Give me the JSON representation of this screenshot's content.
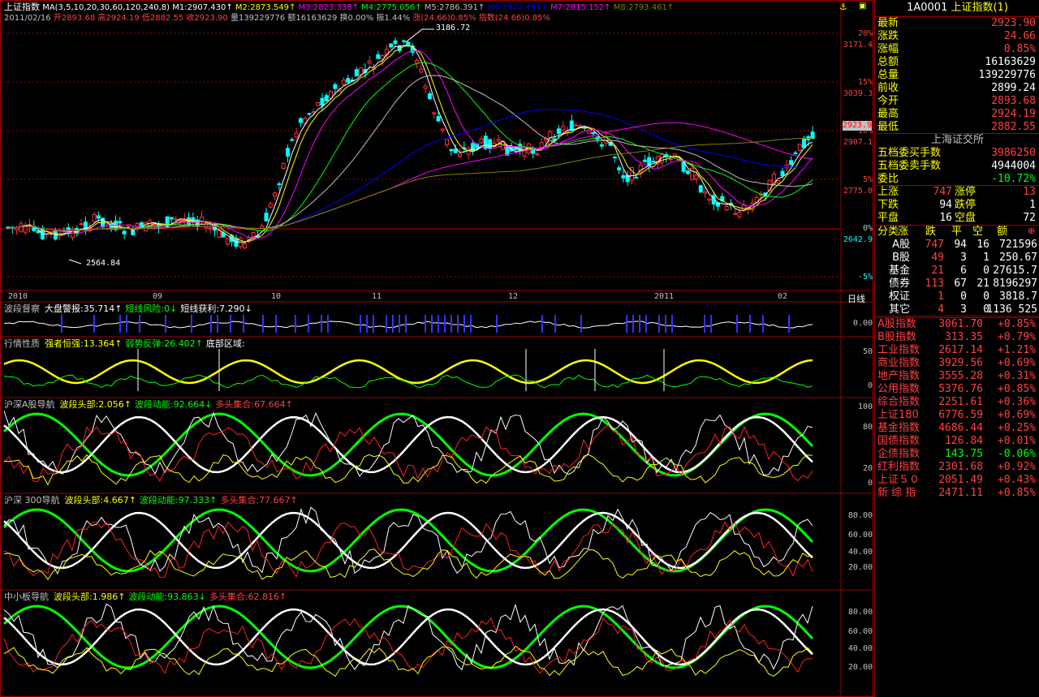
{
  "title": "上证指数",
  "header": {
    "ma_label": "MA(3,5,10,20,30,60,120,240,8)",
    "ma_values": [
      {
        "name": "M1",
        "value": "2907.430",
        "color": "#ffffff"
      },
      {
        "name": "M2",
        "value": "2873.549",
        "color": "#ffff00"
      },
      {
        "name": "M3",
        "value": "2823.338",
        "color": "#ff00ff"
      },
      {
        "name": "M4",
        "value": "2775.056",
        "color": "#00ff00"
      },
      {
        "name": "M5",
        "value": "2786.391",
        "color": "#c0c0c0"
      },
      {
        "name": "M6",
        "value": "2922.491",
        "color": "#0000ff"
      },
      {
        "name": "M7",
        "value": "2815.152",
        "color": "#ff00ff"
      },
      {
        "name": "M8",
        "value": "2793.461",
        "color": "#808000"
      }
    ],
    "line2": [
      {
        "text": "2011/02/16",
        "color": "#c0c0c0"
      },
      {
        "text": "开2893.68",
        "color": "#ff4040"
      },
      {
        "text": "高2924.19",
        "color": "#ff4040"
      },
      {
        "text": "低2882.55",
        "color": "#ff4040"
      },
      {
        "text": "收2923.90",
        "color": "#ff4040"
      },
      {
        "text": "量139229776",
        "color": "#c0c0c0"
      },
      {
        "text": "额16163629",
        "color": "#c0c0c0"
      },
      {
        "text": "换0.00%",
        "color": "#c0c0c0"
      },
      {
        "text": "振1.44%",
        "color": "#c0c0c0"
      },
      {
        "text": "涨(24.66)0.85%",
        "color": "#ff4040"
      },
      {
        "text": "指数(24.66)0.85%",
        "color": "#ff4040"
      }
    ]
  },
  "price_axis": [
    {
      "text": "20%",
      "color": "#ff4040"
    },
    {
      "text": "3171.4",
      "color": "#ff4040"
    },
    {
      "text": "15%",
      "color": "#ff4040"
    },
    {
      "text": "3039.3",
      "color": "#ff4040"
    },
    {
      "text": "10%",
      "color": "#ff4040"
    },
    {
      "text": "2907.1",
      "color": "#ff4040"
    },
    {
      "text": "5%",
      "color": "#ff4040"
    },
    {
      "text": "2775.0",
      "color": "#ff4040"
    },
    {
      "text": "0%",
      "color": "#c0c0c0"
    },
    {
      "text": "2642.9",
      "color": "#00ffff"
    },
    {
      "text": "-5%",
      "color": "#00ffff"
    }
  ],
  "current_price_tag": "2923.9",
  "annotations": {
    "high": "3186.72",
    "low": "2564.84"
  },
  "time_axis": [
    "2010",
    "09",
    "10",
    "11",
    "12",
    "2011",
    "02"
  ],
  "period": "日线",
  "panels": [
    {
      "title": "波段督察",
      "items": [
        {
          "text": "大盘警报:35.714↑",
          "color": "#ffffff"
        },
        {
          "text": "短线风险:0↓",
          "color": "#00ff00"
        },
        {
          "text": "短线获利:7.290↓",
          "color": "#ffffff"
        }
      ],
      "axis": [
        "0.00"
      ]
    },
    {
      "title": "行情性质",
      "items": [
        {
          "text": "强者恒强:13.364↑",
          "color": "#ffff00"
        },
        {
          "text": "弱势反弹:26.402↑",
          "color": "#00ff00"
        },
        {
          "text": "底部区域:",
          "color": "#ffffff"
        }
      ],
      "axis": [
        "50",
        "0"
      ]
    },
    {
      "title": "沪深A股导航",
      "items": [
        {
          "text": "波段头部:2.056↑",
          "color": "#ffff00"
        },
        {
          "text": "波段动能:92.664↓",
          "color": "#00ff00"
        },
        {
          "text": "多头集合:67.664↑",
          "color": "#ff4040"
        }
      ],
      "axis": [
        "100",
        "80",
        "20",
        "0"
      ]
    },
    {
      "title": "沪深 300导航",
      "items": [
        {
          "text": "波段头部:4.667↑",
          "color": "#ffff00"
        },
        {
          "text": "波段动能:97.333↑",
          "color": "#00ff00"
        },
        {
          "text": "多头集合:77.667↑",
          "color": "#ff4040"
        }
      ],
      "axis": [
        "80.00",
        "60.00",
        "40.00",
        "20.00"
      ]
    },
    {
      "title": "中小板导航",
      "items": [
        {
          "text": "波段头部:1.986↑",
          "color": "#ffff00"
        },
        {
          "text": "波段动能:93.863↓",
          "color": "#00ff00"
        },
        {
          "text": "多头集合:62.816↑",
          "color": "#ff4040"
        }
      ],
      "axis": [
        "80.00",
        "60.00",
        "40.00",
        "20.00"
      ]
    }
  ],
  "quote": {
    "code": "1A0001",
    "name": "上证指数(1)",
    "rows": [
      {
        "label": "最新",
        "value": "2923.90",
        "color": "#ff4040"
      },
      {
        "label": "涨跌",
        "value": "24.66",
        "color": "#ff4040"
      },
      {
        "label": "涨幅",
        "value": "0.85%",
        "color": "#ff4040"
      },
      {
        "label": "总额",
        "value": "16163629",
        "color": "#ffffff"
      },
      {
        "label": "总量",
        "value": "139229776",
        "color": "#ffffff"
      },
      {
        "label": "前收",
        "value": "2899.24",
        "color": "#ffffff"
      },
      {
        "label": "今开",
        "value": "2893.68",
        "color": "#ff4040"
      },
      {
        "label": "最高",
        "value": "2924.19",
        "color": "#ff4040"
      },
      {
        "label": "最低",
        "value": "2882.55",
        "color": "#ff4040"
      }
    ]
  },
  "exchange": {
    "name": "上海证交所",
    "rows": [
      {
        "label": "五档委买手数",
        "value": "3986250",
        "color": "#ff4040"
      },
      {
        "label": "五档委卖手数",
        "value": "4944004",
        "color": "#ffffff"
      },
      {
        "label": "委比",
        "value": "-10.72%",
        "color": "#00ff00"
      }
    ]
  },
  "breadth": [
    {
      "l1": "上涨",
      "v1": "747",
      "c1": "#ff4040",
      "l2": "涨停",
      "v2": "13",
      "c2": "#ff4040"
    },
    {
      "l1": "下跌",
      "v1": "94",
      "c1": "#ffffff",
      "l2": "跌停",
      "v2": "1",
      "c2": "#ffffff"
    },
    {
      "l1": "平盘",
      "v1": "16",
      "c1": "#ffffff",
      "l2": "空盘",
      "v2": "72",
      "c2": "#ffffff"
    }
  ],
  "category_table": {
    "headers": [
      "分类",
      "涨",
      "跌",
      "平",
      "空",
      "额"
    ],
    "rows": [
      {
        "name": "A股",
        "up": "747",
        "down": "94",
        "flat": "16",
        "empty": "721596",
        "amt": ""
      },
      {
        "name": "B股",
        "up": "49",
        "down": "3",
        "flat": "1",
        "empty": "",
        "amt": "250.67"
      },
      {
        "name": "基金",
        "up": "21",
        "down": "6",
        "flat": "0",
        "empty": "",
        "amt": "27615.7"
      },
      {
        "name": "债券",
        "up": "113",
        "down": "67",
        "flat": "21",
        "empty": "",
        "amt": "8196297"
      },
      {
        "name": "权证",
        "up": "1",
        "down": "0",
        "flat": "0",
        "empty": "",
        "amt": "3818.7"
      },
      {
        "name": "其它",
        "up": "4",
        "down": "3",
        "flat": "0",
        "empty": "",
        "amt": "1136 525"
      }
    ]
  },
  "indices": [
    {
      "name": "A股指数",
      "value": "3061.70",
      "chg": "+0.85%",
      "color": "#ff4040"
    },
    {
      "name": "B股指数",
      "value": "313.35",
      "chg": "+0.79%",
      "color": "#ff4040"
    },
    {
      "name": "工业指数",
      "value": "2617.14",
      "chg": "+1.21%",
      "color": "#ff4040"
    },
    {
      "name": "商业指数",
      "value": "3929.56",
      "chg": "+0.69%",
      "color": "#ff4040"
    },
    {
      "name": "地产指数",
      "value": "3555.28",
      "chg": "+0.31%",
      "color": "#ff4040"
    },
    {
      "name": "公用指数",
      "value": "5376.76",
      "chg": "+0.85%",
      "color": "#ff4040"
    },
    {
      "name": "综合指数",
      "value": "2251.61",
      "chg": "+0.36%",
      "color": "#ff4040"
    },
    {
      "name": "上证180",
      "value": "6776.59",
      "chg": "+0.69%",
      "color": "#ff4040"
    },
    {
      "name": "基金指数",
      "value": "4686.44",
      "chg": "+0.25%",
      "color": "#ff4040"
    },
    {
      "name": "国债指数",
      "value": "126.84",
      "chg": "+0.01%",
      "color": "#ff4040"
    },
    {
      "name": "企债指数",
      "value": "143.75",
      "chg": "-0.06%",
      "color": "#00ff00"
    },
    {
      "name": "红利指数",
      "value": "2301.68",
      "chg": "+0.92%",
      "color": "#ff4040"
    },
    {
      "name": "上证５０",
      "value": "2051.49",
      "chg": "+0.43%",
      "color": "#ff4040"
    },
    {
      "name": "新 综 指",
      "value": "2471.11",
      "chg": "+0.85%",
      "color": "#ff4040"
    }
  ]
}
